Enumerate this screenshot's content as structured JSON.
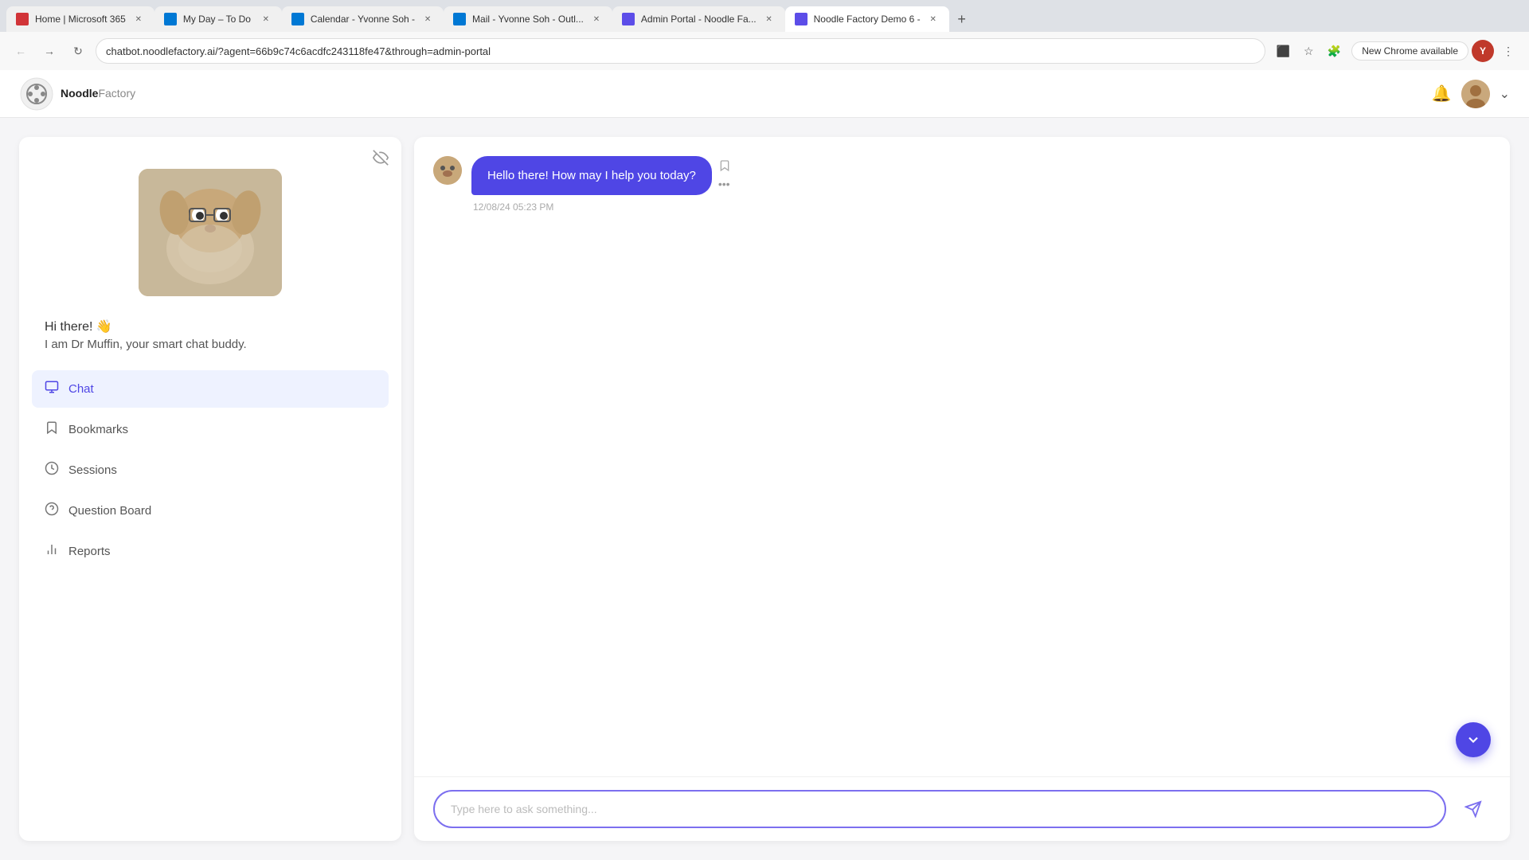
{
  "browser": {
    "url": "chatbot.noodlefactory.ai/?agent=66b9c74c6acdfc243118fe47&through=admin-portal",
    "new_chrome_label": "New Chrome available",
    "tabs": [
      {
        "id": "t1",
        "title": "Home | Microsoft 365",
        "favicon_type": "ms365",
        "active": false
      },
      {
        "id": "t2",
        "title": "My Day – To Do",
        "favicon_type": "todo",
        "active": false
      },
      {
        "id": "t3",
        "title": "Calendar - Yvonne Soh -",
        "favicon_type": "calendar",
        "active": false
      },
      {
        "id": "t4",
        "title": "Mail - Yvonne Soh - Outl...",
        "favicon_type": "mail",
        "active": false
      },
      {
        "id": "t5",
        "title": "Admin Portal - Noodle Fa...",
        "favicon_type": "admin",
        "active": false
      },
      {
        "id": "t6",
        "title": "Noodle Factory Demo 6 -",
        "favicon_type": "demo",
        "active": true
      }
    ]
  },
  "logo": {
    "brand": "Noodle",
    "brand2": "Factory"
  },
  "bot": {
    "greeting": "Hi there! 👋",
    "intro": "I am Dr Muffin, your smart chat buddy."
  },
  "nav": {
    "items": [
      {
        "id": "chat",
        "label": "Chat",
        "icon": "💬",
        "active": true
      },
      {
        "id": "bookmarks",
        "label": "Bookmarks",
        "icon": "🔖",
        "active": false
      },
      {
        "id": "sessions",
        "label": "Sessions",
        "icon": "🕐",
        "active": false
      },
      {
        "id": "question_board",
        "label": "Question Board",
        "icon": "❓",
        "active": false
      },
      {
        "id": "reports",
        "label": "Reports",
        "icon": "📊",
        "active": false
      }
    ]
  },
  "chat": {
    "bot_message": "Hello there! How may I help you today?",
    "message_time": "12/08/24 05:23 PM",
    "input_placeholder": "Type here to ask something..."
  }
}
